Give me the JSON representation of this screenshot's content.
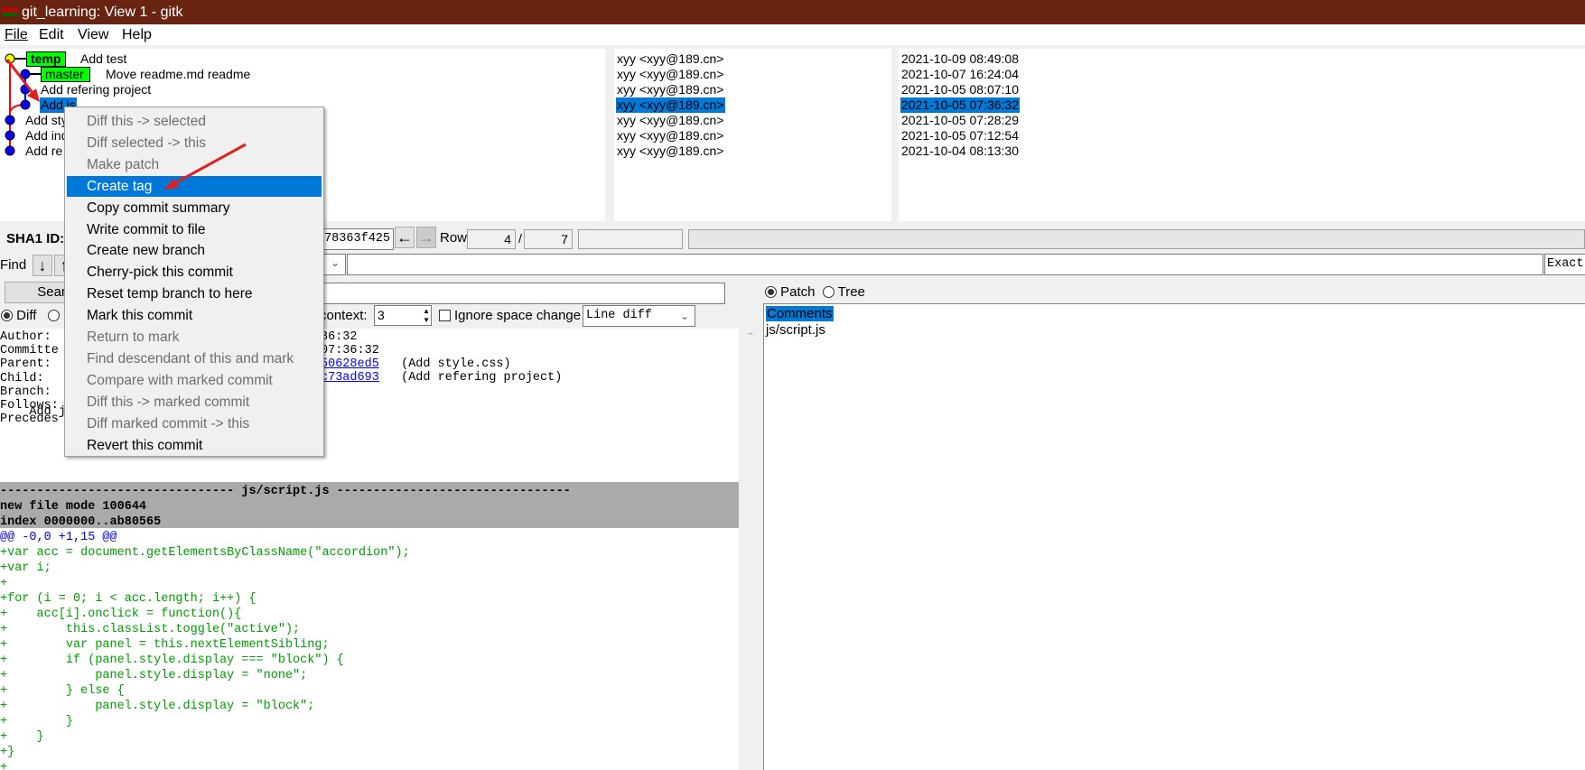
{
  "window": {
    "title": "git_learning: View 1 - gitk"
  },
  "menubar": [
    "File",
    "Edit",
    "View",
    "Help"
  ],
  "commits": [
    {
      "subject": "Add test",
      "tag": "temp",
      "author": "xyy <xyy@189.cn>",
      "date": "2021-10-09 08:49:08"
    },
    {
      "subject": "Move readme.md readme",
      "tag": "master",
      "author": "xyy <xyy@189.cn>",
      "date": "2021-10-07 16:24:04"
    },
    {
      "subject": "Add refering project",
      "author": "xyy <xyy@189.cn>",
      "date": "2021-10-05 08:07:10"
    },
    {
      "subject": "Add js",
      "author": "xyy <xyy@189.cn>",
      "date": "2021-10-05 07:36:32",
      "selected": true
    },
    {
      "subject": "Add sty",
      "author": "xyy <xyy@189.cn>",
      "date": "2021-10-05 07:28:29"
    },
    {
      "subject": "Add ind",
      "author": "xyy <xyy@189.cn>",
      "date": "2021-10-05 07:12:54"
    },
    {
      "subject": "Add re",
      "author": "xyy <xyy@189.cn>",
      "date": "2021-10-04 08:13:30"
    }
  ],
  "context_menu": [
    {
      "label": "Diff this -> selected",
      "disabled": true
    },
    {
      "label": "Diff selected -> this",
      "disabled": true
    },
    {
      "label": "Make patch",
      "disabled": true
    },
    {
      "label": "Create tag",
      "highlighted": true
    },
    {
      "label": "Copy commit summary"
    },
    {
      "label": "Write commit to file"
    },
    {
      "label": "Create new branch"
    },
    {
      "label": "Cherry-pick this commit"
    },
    {
      "label": "Reset temp branch to here"
    },
    {
      "label": "Mark this commit"
    },
    {
      "label": "Return to mark",
      "disabled": true
    },
    {
      "label": "Find descendant of this and mark",
      "disabled": true
    },
    {
      "label": "Compare with marked commit",
      "disabled": true
    },
    {
      "label": "Diff this -> marked commit",
      "disabled": true
    },
    {
      "label": "Diff marked commit -> this",
      "disabled": true
    },
    {
      "label": "Revert this commit"
    }
  ],
  "toolbar": {
    "sha1_label": "SHA1 ID:",
    "sha1_value": "178363f425",
    "row_label": "Row",
    "row_current": "4",
    "row_sep": "/",
    "row_total": "7",
    "find_label": "Find",
    "find_mode": "Exact",
    "search_button": "Search"
  },
  "diff_options": {
    "diff_label": "Diff",
    "context_label": "context:",
    "context_value": "3",
    "ignore_space_label": "Ignore space change",
    "diff_mode": "Line diff"
  },
  "details": {
    "labels": [
      "Author:",
      "Committe",
      "Parent:",
      "Child:",
      "Branch:",
      "Follows:",
      "Precedes"
    ],
    "author_tail": "36:32",
    "committer_tail": "07:36:32",
    "parent_link": "50628ed5",
    "parent_desc": " (Add style.css)",
    "child_link": "c73ad693",
    "child_desc": " (Add refering project)",
    "message": "    Add js"
  },
  "diff": {
    "file_header": "-------------------------------- js/script.js --------------------------------",
    "meta": [
      "new file mode 100644",
      "index 0000000..ab80565"
    ],
    "hunk": "@@ -0,0 +1,15 @@",
    "lines": [
      "+var acc = document.getElementsByClassName(\"accordion\");",
      "+var i;",
      "+",
      "+for (i = 0; i < acc.length; i++) {",
      "+    acc[i].onclick = function(){",
      "+        this.classList.toggle(\"active\");",
      "+        var panel = this.nextElementSibling;",
      "+        if (panel.style.display === \"block\") {",
      "+            panel.style.display = \"none\";",
      "+        } else {",
      "+            panel.style.display = \"block\";",
      "+        }",
      "+    }",
      "+}",
      "+"
    ]
  },
  "file_list": {
    "patch_label": "Patch",
    "tree_label": "Tree",
    "items": [
      "Comments",
      "js/script.js"
    ]
  },
  "colors": {
    "titlebar": "#682410",
    "selection": "#0078d7",
    "tag": "#00ff00",
    "added": "#00a000",
    "hunk": "#0000ff",
    "annotation_arrow": "#e02020"
  }
}
